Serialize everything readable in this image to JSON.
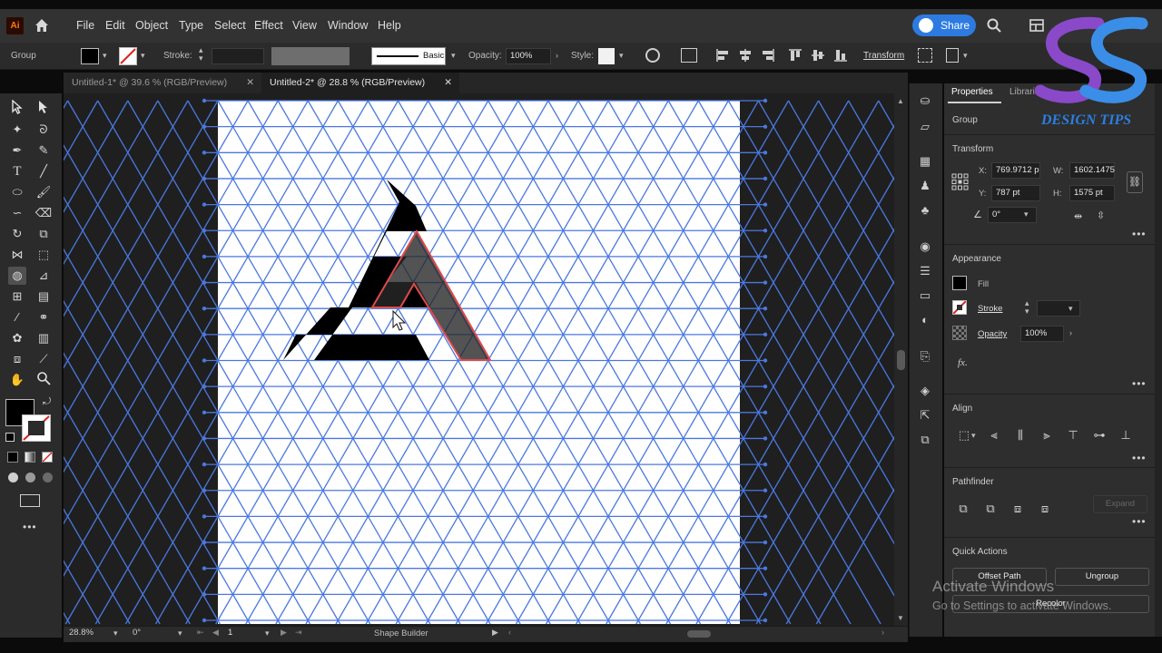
{
  "app": {
    "logo": "Ai"
  },
  "menu": [
    "File",
    "Edit",
    "Object",
    "Type",
    "Select",
    "Effect",
    "View",
    "Window",
    "Help"
  ],
  "share_label": "Share",
  "control": {
    "selection": "Group",
    "stroke_label": "Stroke:",
    "brush_label": "Basic",
    "opacity_label": "Opacity:",
    "opacity_value": "100%",
    "style_label": "Style:",
    "transform_label": "Transform"
  },
  "tabs": [
    {
      "label": "Untitled-1* @ 39.6 % (RGB/Preview)",
      "active": false
    },
    {
      "label": "Untitled-2* @ 28.8 % (RGB/Preview)",
      "active": true
    }
  ],
  "status": {
    "zoom": "28.8%",
    "rotate": "0°",
    "artboard": "1",
    "tool": "Shape Builder"
  },
  "panel": {
    "tabs": [
      "Properties",
      "Librari"
    ],
    "selection": "Group",
    "transform": {
      "title": "Transform",
      "x_label": "X:",
      "x": "769.9712 p",
      "y_label": "Y:",
      "y": "787 pt",
      "w_label": "W:",
      "w": "1602.1475",
      "h_label": "H:",
      "h": "1575 pt",
      "angle": "0°"
    },
    "appearance": {
      "title": "Appearance",
      "fill": "Fill",
      "stroke": "Stroke",
      "opacity_label": "Opacity",
      "opacity": "100%",
      "fx": "fx."
    },
    "align": {
      "title": "Align"
    },
    "pathfinder": {
      "title": "Pathfinder",
      "expand": "Expand"
    },
    "quick_actions": {
      "title": "Quick Actions",
      "offset_path": "Offset Path",
      "ungroup": "Ungroup",
      "recolor": "Recolor"
    }
  },
  "watermark": {
    "title": "Activate Windows",
    "subtitle": "Go to Settings to activate Windows."
  },
  "brand": {
    "text": "DESIGN TIPS"
  },
  "colors": {
    "grid": "#4a78e0",
    "accent": "#2d7be0",
    "brand": "#8a49c9",
    "selection": "#e04a4a"
  },
  "icons": [
    "home-icon",
    "search-icon",
    "arrange-icon",
    "selection-tool-icon",
    "direct-selection-icon",
    "pen-icon",
    "type-icon",
    "shape-builder-icon",
    "hand-icon",
    "zoom-icon",
    "layers-icon"
  ]
}
